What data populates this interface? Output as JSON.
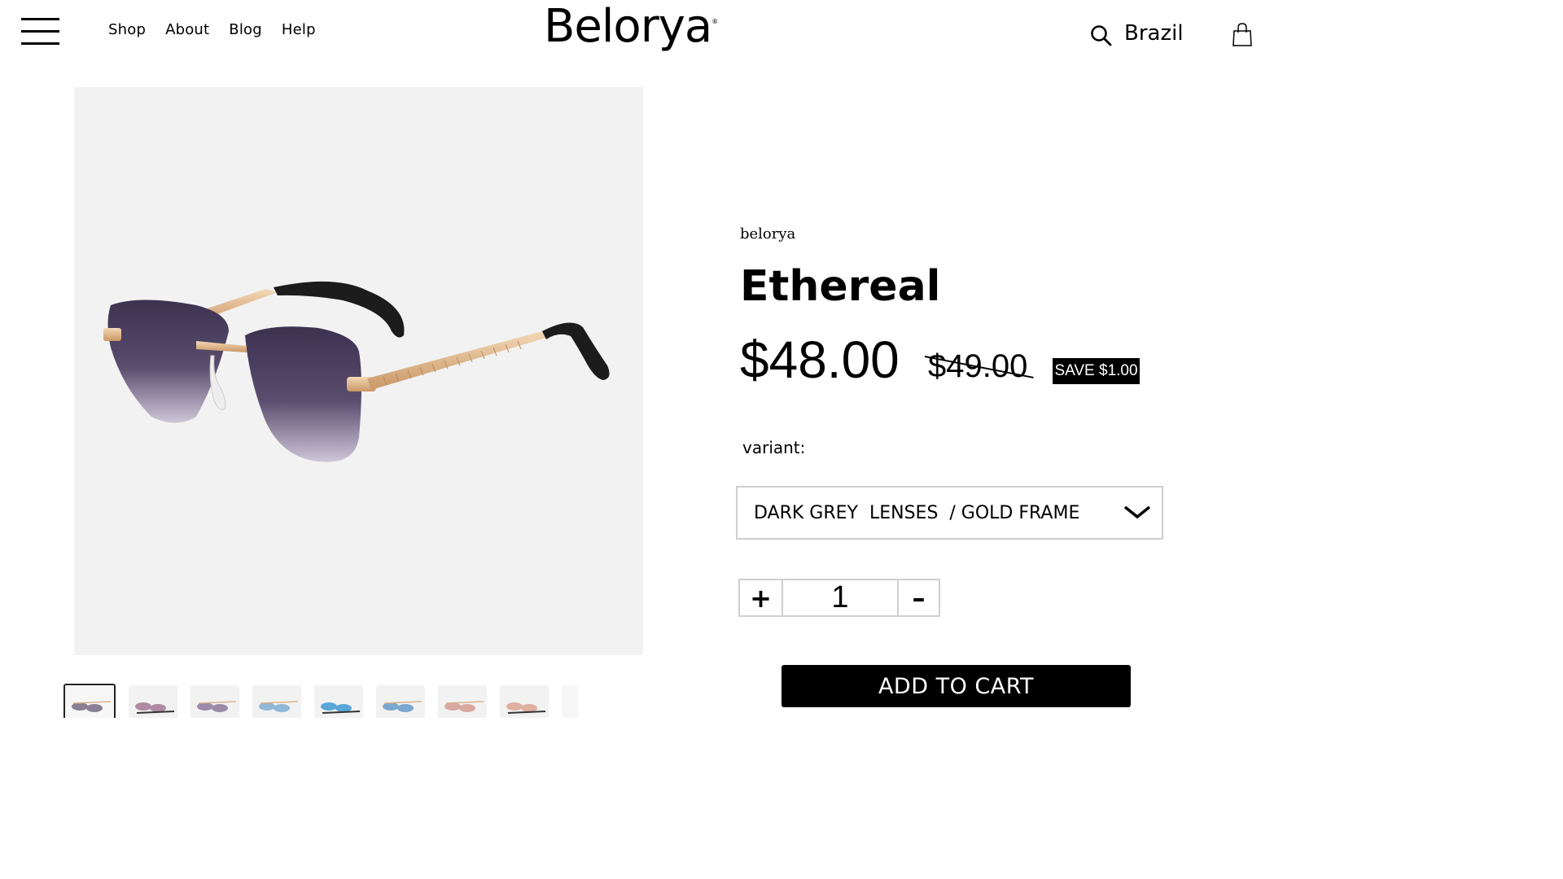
{
  "header": {
    "nav": [
      "Shop",
      "About",
      "Blog",
      "Help"
    ],
    "logo": "Belorya",
    "logo_mark": "®",
    "country": "Brazil"
  },
  "product": {
    "brand": "belorya",
    "title": "Ethereal",
    "price": "$48.00",
    "compare_price": "$49.00",
    "save_badge": "SAVE $1.00",
    "variant_label": "variant:",
    "variant_selected": "DARK GREY  LENSES  / GOLD FRAME",
    "quantity": "1",
    "plus_label": "+",
    "minus_label": "–",
    "add_to_cart": "ADD TO CART"
  },
  "thumbnails": [
    {
      "lens": "#8a7f94",
      "frame": "#d9b38c"
    },
    {
      "lens": "#b08aa4",
      "frame": "#333333"
    },
    {
      "lens": "#9b8aa8",
      "frame": "#d9b38c"
    },
    {
      "lens": "#8fb8d8",
      "frame": "#d9b38c"
    },
    {
      "lens": "#5aa6d8",
      "frame": "#333333"
    },
    {
      "lens": "#7aa8d0",
      "frame": "#d9b38c"
    },
    {
      "lens": "#d9a8a0",
      "frame": "#d9b38c"
    },
    {
      "lens": "#e0b0a0",
      "frame": "#333333"
    }
  ],
  "colors": {
    "background": "#ffffff",
    "image_bg": "#f2f2f2",
    "lens_dark": "#3f3554",
    "frame_gold": "#e0b88f",
    "button_bg": "#000000"
  }
}
